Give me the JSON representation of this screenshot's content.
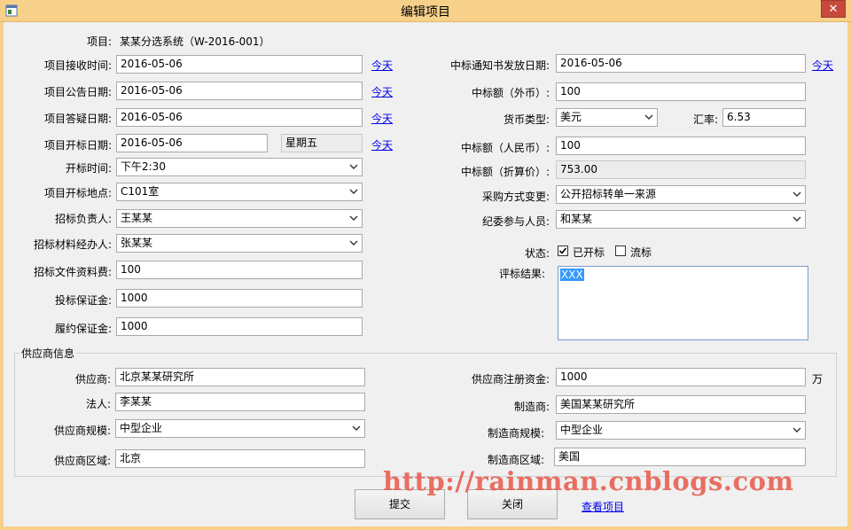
{
  "window": {
    "title": "编辑项目",
    "close_glyph": "✕"
  },
  "project": {
    "label": "项目:",
    "value": "某某分选系统（W-2016-001）"
  },
  "left": {
    "receive_date": {
      "label": "项目接收时间:",
      "value": "2016-05-06",
      "today": "今天"
    },
    "announce_date": {
      "label": "项目公告日期:",
      "value": "2016-05-06",
      "today": "今天"
    },
    "qa_date": {
      "label": "项目答疑日期:",
      "value": "2016-05-06",
      "today": "今天"
    },
    "open_date": {
      "label": "项目开标日期:",
      "value": "2016-05-06",
      "weekday": "星期五",
      "today": "今天"
    },
    "open_time": {
      "label": "开标时间:",
      "value": "下午2:30"
    },
    "open_place": {
      "label": "项目开标地点:",
      "value": "C101室"
    },
    "bid_owner": {
      "label": "招标负责人:",
      "value": "王某某"
    },
    "material_handler": {
      "label": "招标材料经办人:",
      "value": "张某某"
    },
    "doc_fee": {
      "label": "招标文件资料费:",
      "value": "100"
    },
    "bid_bond": {
      "label": "投标保证金:",
      "value": "1000"
    },
    "perf_bond": {
      "label": "履约保证金:",
      "value": "1000"
    }
  },
  "right": {
    "notice_date": {
      "label": "中标通知书发放日期:",
      "value": "2016-05-06",
      "today": "今天"
    },
    "amount_foreign": {
      "label": "中标额（外币）:",
      "value": "100"
    },
    "currency": {
      "label": "货币类型:",
      "value": "美元"
    },
    "rate": {
      "label": "汇率:",
      "value": "6.53"
    },
    "amount_rmb": {
      "label": "中标额（人民币）:",
      "value": "100"
    },
    "amount_converted": {
      "label": "中标额（折算价）:",
      "value": "753.00"
    },
    "purchase_change": {
      "label": "采购方式变更:",
      "value": "公开招标转单一来源"
    },
    "discipline_member": {
      "label": "纪委参与人员:",
      "value": "和某某"
    },
    "status": {
      "label": "状态:",
      "opened": "已开标",
      "opened_checked": true,
      "failed": "流标",
      "failed_checked": false
    },
    "evaluation": {
      "label": "评标结果:",
      "value": "XXX"
    }
  },
  "supplier": {
    "group_title": "供应商信息",
    "name": {
      "label": "供应商:",
      "value": "北京某某研究所"
    },
    "legal": {
      "label": "法人:",
      "value": "李某某"
    },
    "scale": {
      "label": "供应商规模:",
      "value": "中型企业"
    },
    "region": {
      "label": "供应商区域:",
      "value": "北京"
    },
    "capital": {
      "label": "供应商注册资金:",
      "value": "1000",
      "unit": "万"
    },
    "maker": {
      "label": "制造商:",
      "value": "美国某某研究所"
    },
    "maker_scale": {
      "label": "制造商规模:",
      "value": "中型企业"
    },
    "maker_region": {
      "label": "制造商区域:",
      "value": "美国"
    }
  },
  "actions": {
    "submit": "提交",
    "close": "关闭",
    "view": "查看项目"
  },
  "watermark": "http://rainman.cnblogs.com",
  "colors": {
    "titlebar": "#f7d08a",
    "close": "#c7493d",
    "link": "#0000ee",
    "selection": "#3399ff",
    "watermark": "#e8584a"
  }
}
